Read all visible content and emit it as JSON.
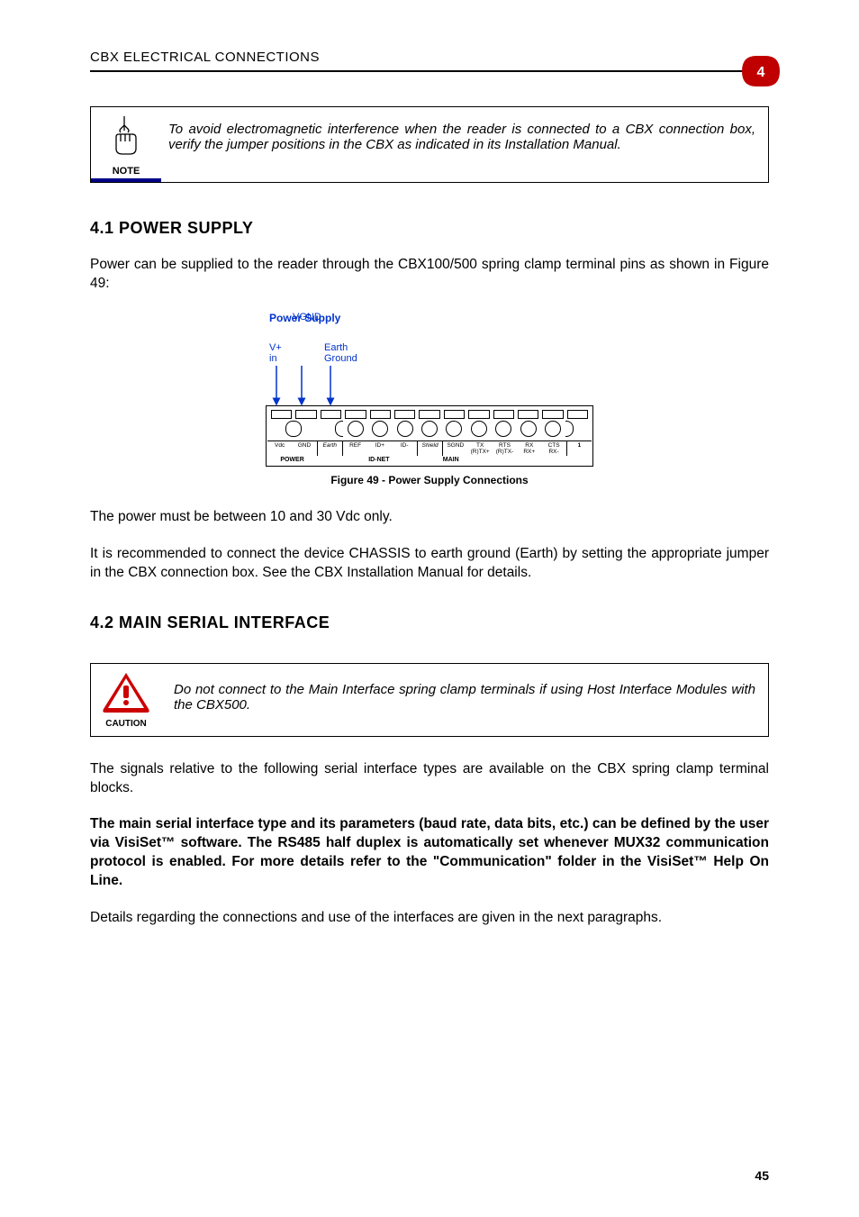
{
  "header": {
    "title": "CBX ELECTRICAL CONNECTIONS",
    "chapter_number": "4"
  },
  "note": {
    "label": "NOTE",
    "text": "To avoid electromagnetic interference when the reader is connected to a CBX connection box, verify the jumper positions in the CBX as indicated in its Installation Manual."
  },
  "section_4_1": {
    "heading": "4.1  POWER SUPPLY",
    "intro": "Power can be supplied to the reader through the CBX100/500 spring clamp terminal pins as shown in Figure 49:",
    "figure": {
      "title_label": "Power Supply",
      "vgnd": "VGND",
      "v_in_1": "V+",
      "v_in_2": "in",
      "earth_1": "Earth",
      "earth_2": "Ground",
      "caption": "Figure 49 - Power Supply Connections",
      "terminals": {
        "vdc": "Vdc",
        "gnd": "GND",
        "power": "POWER",
        "earth": "Earth",
        "ref": "REF",
        "idp": "ID+",
        "idm": "ID-",
        "idnet": "ID-NET",
        "shield": "Shield",
        "sgnd": "SGND",
        "main": "MAIN",
        "tx": "TX",
        "rtxp": "(R)TX+",
        "rts": "RTS",
        "rtxm": "(R)TX-",
        "rx": "RX",
        "rxp": "RX+",
        "cts": "CTS",
        "rxm": "RX-",
        "one": "1"
      }
    },
    "para_voltage": "The power must be between 10 and 30 Vdc only.",
    "para_chassis": "It is recommended to connect the device CHASSIS to earth ground (Earth) by setting the appropriate jumper in the CBX connection box. See the CBX Installation Manual for details."
  },
  "section_4_2": {
    "heading": "4.2  MAIN SERIAL INTERFACE",
    "caution": {
      "label": "CAUTION",
      "text": "Do not connect to the Main Interface spring clamp terminals if using Host Interface Modules with the CBX500."
    },
    "para_signals": "The signals relative to the following serial interface types are available on the CBX spring clamp terminal blocks.",
    "para_bold": "The main serial interface type and its parameters (baud rate, data bits, etc.) can be defined by the user via VisiSet™ software. The RS485 half duplex is automatically set whenever MUX32 communication protocol is enabled. For more details refer to the \"Communication\" folder in the VisiSet™ Help On Line.",
    "para_details": "Details regarding the connections and use of the interfaces are given in the next paragraphs."
  },
  "page_number": "45"
}
